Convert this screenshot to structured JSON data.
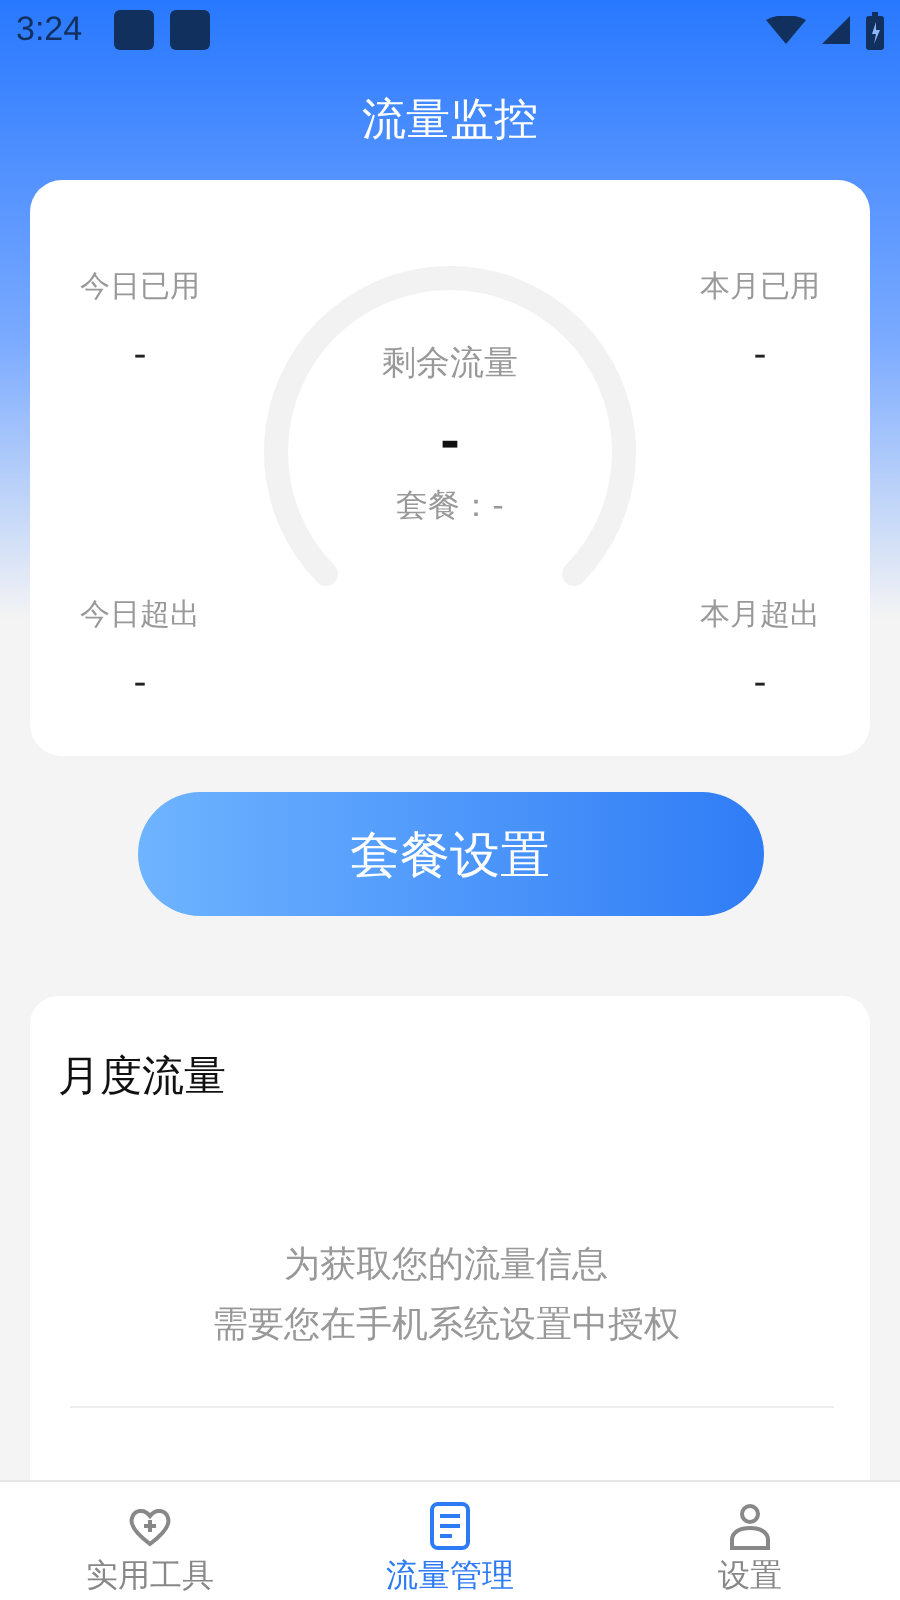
{
  "status_bar": {
    "time": "3:24"
  },
  "header": {
    "title": "流量监控"
  },
  "summary": {
    "gauge_label": "剩余流量",
    "gauge_value": "-",
    "plan": "套餐：-",
    "stats": [
      {
        "label": "今日已用",
        "value": "-"
      },
      {
        "label": "本月已用",
        "value": "-"
      },
      {
        "label": "今日超出",
        "value": "-"
      },
      {
        "label": "本月超出",
        "value": "-"
      }
    ]
  },
  "plan_button": "套餐设置",
  "monthly": {
    "title": "月度流量",
    "message_lines": [
      "为获取您的流量信息",
      "需要您在手机系统设置中授权"
    ]
  },
  "nav": [
    {
      "label": "实用工具",
      "selected": false
    },
    {
      "label": "流量管理",
      "selected": true
    },
    {
      "label": "设置",
      "selected": false
    }
  ]
}
